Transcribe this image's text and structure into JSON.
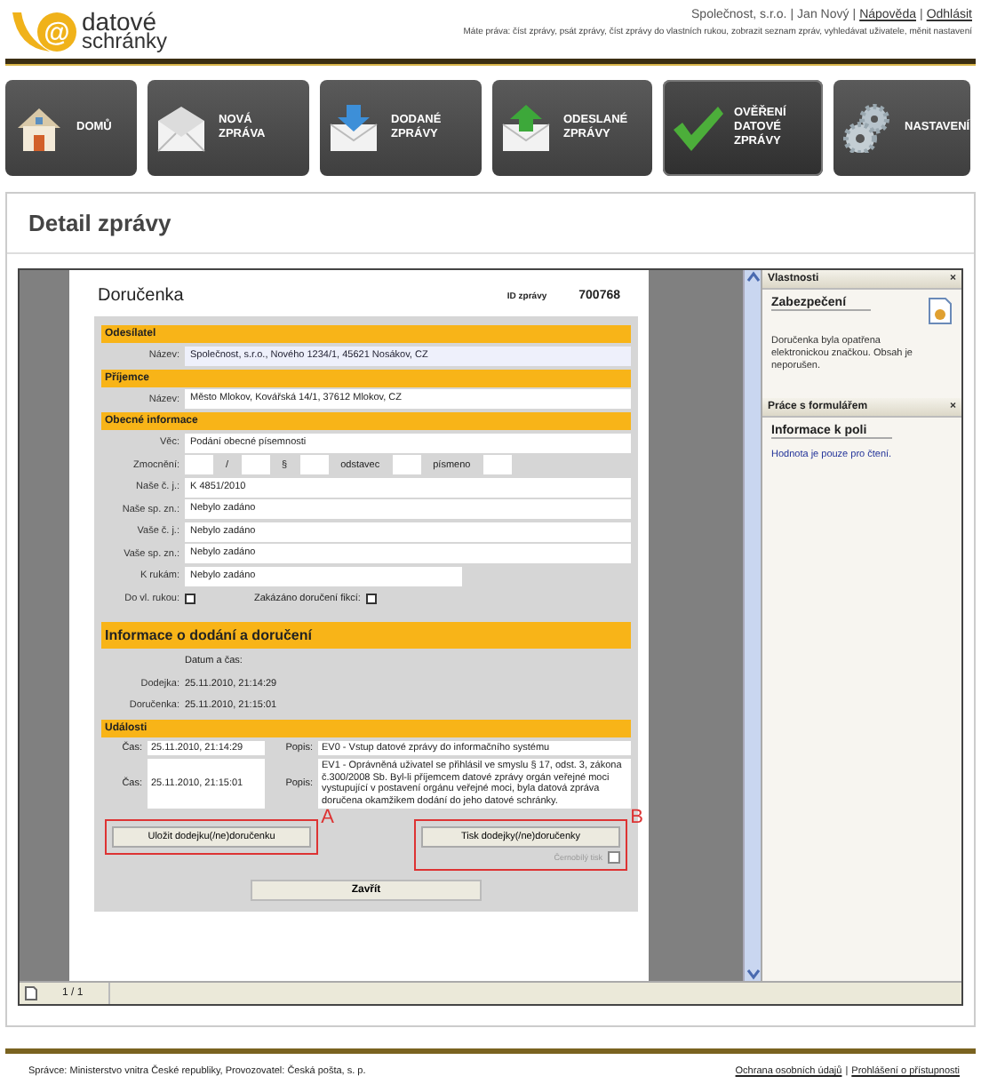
{
  "header": {
    "logo": {
      "at": "@",
      "line1": "datové",
      "line2": "schránky"
    },
    "separator": "|",
    "user_bar": [
      {
        "kind": "text",
        "text": "Společnost, s.r.o."
      },
      {
        "kind": "text",
        "text": "Jan Nový"
      },
      {
        "kind": "link",
        "text": "Nápověda"
      },
      {
        "kind": "link",
        "text": "Odhlásit"
      }
    ],
    "rights": "Máte práva: číst zprávy, psát zprávy, číst zprávy do vlastních rukou, zobrazit seznam zpráv, vyhledávat uživatele, měnit nastavení"
  },
  "nav": [
    {
      "label": "DOMŮ",
      "selected": false
    },
    {
      "label": "NOVÁ ZPRÁVA",
      "selected": false
    },
    {
      "label": "DODANÉ ZPRÁVY",
      "selected": false
    },
    {
      "label": "ODESLANÉ ZPRÁVY",
      "selected": false
    },
    {
      "label": "OVĚŘENÍ DATOVÉ ZPRÁVY",
      "selected": true
    },
    {
      "label": "NASTAVENÍ",
      "selected": false
    }
  ],
  "page_title": "Detail zprávy",
  "document": {
    "title": "Doručenka",
    "id_label": "ID zprávy",
    "id_value": "700768",
    "sections": [
      {
        "title": "Odesílatel",
        "kind": "normal",
        "rows": [
          {
            "kind": "field",
            "label": "Název:",
            "value": "Společnost, s.r.o., Nového 1234/1, 45621 Nosákov, CZ",
            "highlighted": true
          }
        ]
      },
      {
        "title": "Příjemce",
        "kind": "normal",
        "rows": [
          {
            "kind": "field",
            "label": "Název:",
            "value": "Město Mlokov, Kovářská 14/1, 37612 Mlokov, CZ"
          }
        ]
      },
      {
        "title": "Obecné informace",
        "kind": "normal",
        "rows": [
          {
            "kind": "field",
            "label": "Věc:",
            "value": "Podání obecné písemnosti"
          },
          {
            "kind": "authorization",
            "label": "Zmocnění:",
            "parts": [
              "/",
              "§",
              "odstavec",
              "písmeno"
            ]
          },
          {
            "kind": "field",
            "label": "Naše č. j.:",
            "value": "K 4851/2010"
          },
          {
            "kind": "field",
            "label": "Naše sp. zn.:",
            "value": "Nebylo zadáno"
          },
          {
            "kind": "field",
            "label": "Vaše č. j.:",
            "value": "Nebylo zadáno"
          },
          {
            "kind": "field",
            "label": "Vaše sp. zn.:",
            "value": "Nebylo zadáno"
          },
          {
            "kind": "short_field",
            "label": "K rukám:",
            "value": "Nebylo zadáno"
          },
          {
            "kind": "checkboxes",
            "items": [
              {
                "label": "Do vl. rukou:",
                "checked": false
              },
              {
                "label": "Zakázáno doručení fikcí:",
                "checked": false
              }
            ]
          }
        ]
      },
      {
        "title": "Informace o dodání a doručení",
        "kind": "large",
        "rows": [
          {
            "kind": "caption",
            "text": "Datum a čas:"
          },
          {
            "kind": "plain",
            "label": "Dodejka:",
            "value": "25.11.2010, 21:14:29"
          },
          {
            "kind": "plain",
            "label": "Doručenka:",
            "value": "25.11.2010, 21:15:01"
          }
        ]
      },
      {
        "title": "Události",
        "kind": "normal",
        "rows": [
          {
            "kind": "event",
            "time_label": "Čas:",
            "time": "25.11.2010, 21:14:29",
            "desc_label": "Popis:",
            "desc": "EV0 - Vstup datové zprávy do informačního systému"
          },
          {
            "kind": "event",
            "time_label": "Čas:",
            "time": "25.11.2010, 21:15:01",
            "desc_label": "Popis:",
            "desc": "EV1 - Oprávněná uživatel se přihlásil ve smyslu § 17, odst. 3, zákona č.300/2008 Sb. Byl-li příjemcem datové zprávy orgán veřejné moci vystupující v postavení orgánu veřejné moci, byla datová zpráva doručena okamžikem dodání do jeho datové schránky."
          }
        ]
      }
    ],
    "save_button": {
      "label": "Uložit dodejku(/ne)doručenku",
      "marker": "A"
    },
    "print_button": {
      "label": "Tisk dodejky(/ne)doručenky",
      "marker": "B"
    },
    "bw_print": {
      "label": "Černobílý tisk",
      "checked": false,
      "disabled": true
    },
    "close_button": "Zavřít"
  },
  "side_panel": [
    {
      "title": "Vlastnosti",
      "close": "×",
      "heading": "Zabezpečení",
      "kind": "security",
      "text": "Doručenka byla opatřena elektronickou značkou. Obsah je neporušen."
    },
    {
      "title": "Práce s formulářem",
      "close": "×",
      "heading": "Informace k poli",
      "kind": "info",
      "text": "Hodnota je pouze pro čtení."
    }
  ],
  "status_bar": {
    "page": "1 / 1"
  },
  "footer": {
    "text": "Správce: Ministerstvo vnitra České republiky, Provozovatel: Česká pošta, s. p.",
    "links": [
      "Ochrana osobních údajů",
      "Prohlášení o přístupnosti"
    ],
    "separator": "|"
  }
}
